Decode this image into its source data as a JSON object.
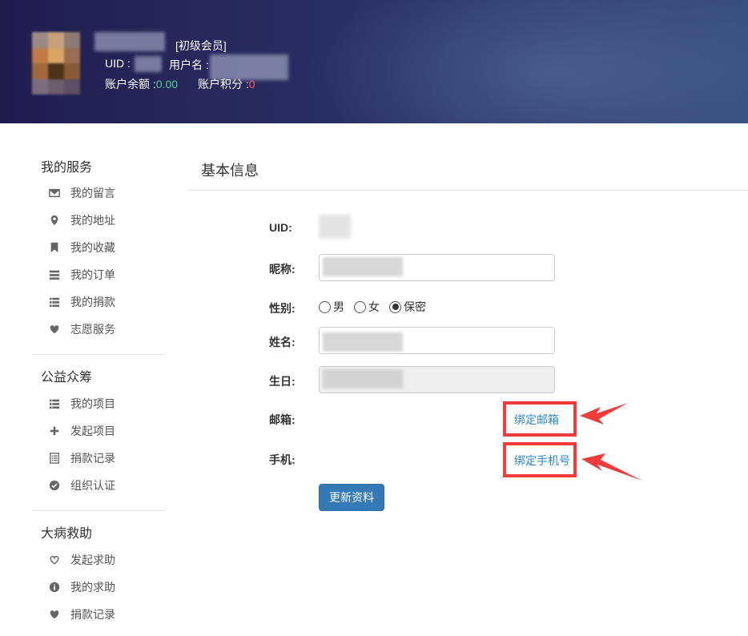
{
  "header": {
    "member_level": "[初级会员]",
    "uid_label": "UID :",
    "username_label": "用户名 :",
    "balance_label": "账户余额 :",
    "balance_value": "0.00",
    "points_label": "账户积分 :",
    "points_value": "0"
  },
  "sidebar": {
    "sections": [
      {
        "title": "我的服务",
        "items": [
          {
            "label": "我的留言",
            "icon": "envelope-icon"
          },
          {
            "label": "我的地址",
            "icon": "map-marker-icon"
          },
          {
            "label": "我的收藏",
            "icon": "bookmark-icon"
          },
          {
            "label": "我的订单",
            "icon": "server-icon"
          },
          {
            "label": "我的捐款",
            "icon": "list-icon"
          },
          {
            "label": "志愿服务",
            "icon": "heart-icon"
          }
        ]
      },
      {
        "title": "公益众筹",
        "items": [
          {
            "label": "我的项目",
            "icon": "list-icon"
          },
          {
            "label": "发起项目",
            "icon": "plus-icon"
          },
          {
            "label": "捐款记录",
            "icon": "list-alt-icon"
          },
          {
            "label": "组织认证",
            "icon": "ok-sign-icon"
          }
        ]
      },
      {
        "title": "大病救助",
        "items": [
          {
            "label": "发起求助",
            "icon": "heart-empty-icon"
          },
          {
            "label": "我的求助",
            "icon": "info-sign-icon"
          },
          {
            "label": "捐款记录",
            "icon": "heart-icon"
          }
        ]
      }
    ]
  },
  "main": {
    "title": "基本信息",
    "form": {
      "uid_label": "UID:",
      "nickname_label": "昵称:",
      "gender_label": "性别:",
      "gender_options": [
        "男",
        "女",
        "保密"
      ],
      "gender_selected": "保密",
      "name_label": "姓名:",
      "birthday_label": "生日:",
      "email_label": "邮箱:",
      "bind_email": "绑定邮箱",
      "phone_label": "手机:",
      "bind_phone": "绑定手机号",
      "submit": "更新资料"
    }
  },
  "colors": {
    "header_start": "#211c4e",
    "header_end": "#3a507f",
    "link": "#2a86d8",
    "primary_button": "#337ab7",
    "highlight": "#f23c3c",
    "balance": "#43d19a",
    "points": "#ff5a64"
  }
}
